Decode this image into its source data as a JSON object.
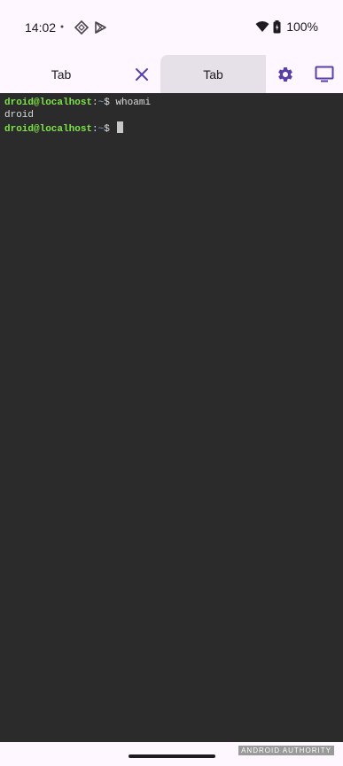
{
  "status_bar": {
    "time": "14:02",
    "battery": "100%",
    "icons": [
      "dot-icon",
      "diamond-app-icon",
      "play-store-icon",
      "wifi-icon",
      "battery-icon"
    ]
  },
  "tabs": [
    {
      "label": "Tab",
      "active": false
    },
    {
      "label": "Tab",
      "active": true
    }
  ],
  "toolbar": {
    "close_icon": "close-icon",
    "settings_icon": "gear-icon",
    "display_icon": "monitor-icon",
    "accent_color": "#5b3fa8"
  },
  "terminal": {
    "lines": [
      {
        "user": "droid@localhost",
        "sep": ":",
        "path": "~",
        "prompt": "$ ",
        "command": "whoami"
      },
      {
        "output": "droid"
      },
      {
        "user": "droid@localhost",
        "sep": ":",
        "path": "~",
        "prompt": "$ ",
        "command": ""
      }
    ],
    "background": "#2b2b2b",
    "user_color": "#7ee34a"
  },
  "watermark": "ANDROID AUTHORITY"
}
